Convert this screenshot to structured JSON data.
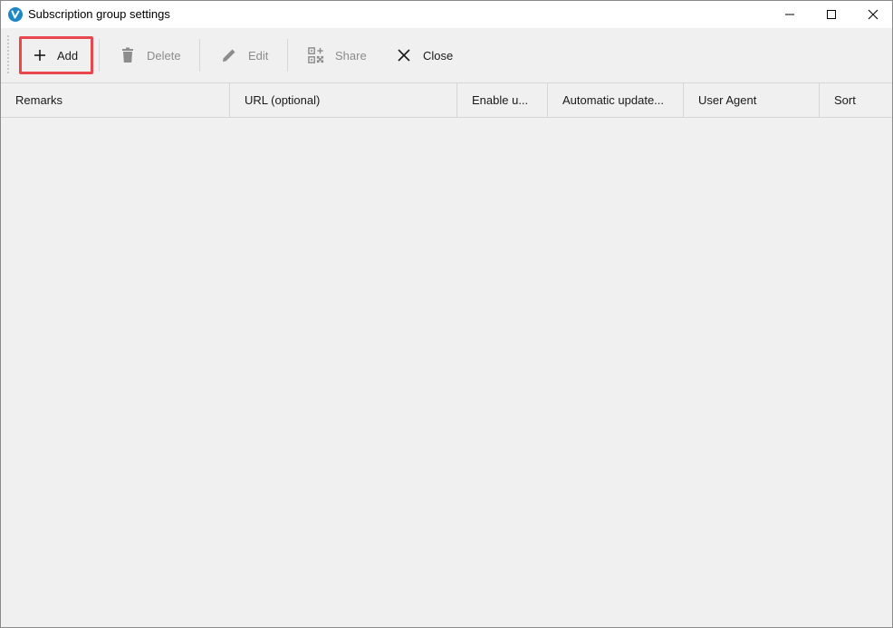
{
  "window": {
    "title": "Subscription group settings",
    "app_icon": "v2ray-logo-icon",
    "controls": [
      "minimize-icon",
      "maximize-icon",
      "close-icon"
    ]
  },
  "toolbar": {
    "add_label": "Add",
    "delete_label": "Delete",
    "edit_label": "Edit",
    "share_label": "Share",
    "close_label": "Close",
    "highlight_color": "#e8474f",
    "disabled_color": "#8c8c8c"
  },
  "grid": {
    "columns": [
      "Remarks",
      "URL (optional)",
      "Enable u...",
      "Automatic update...",
      "User Agent",
      "Sort"
    ],
    "rows": []
  }
}
